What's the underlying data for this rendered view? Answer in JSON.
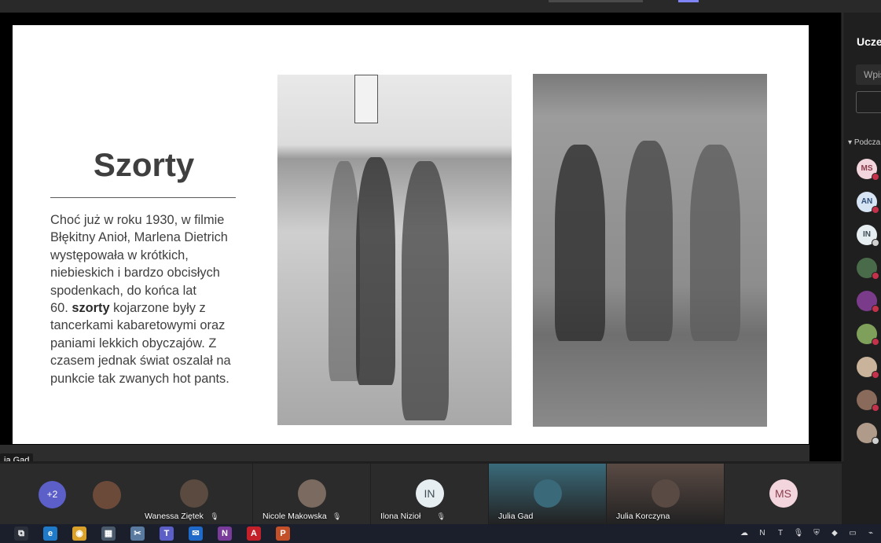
{
  "slide": {
    "title": "Szorty",
    "body_before": "Choć już w roku 1930, w filmie\nBłękitny Anioł, Marlena Dietrich\nwystępowała w krótkich,\nniebieskich i bardzo obcisłych\nspodenkach, do końca lat\n60. ",
    "body_bold": "szorty",
    "body_after": " kojarzone były z\ntancerkami kabaretowymi oraz\npaniami lekkich obyczajów. Z\nczasem jednak świat oszalał na\npunkcie tak zwanych  hot pants."
  },
  "speaker_tooltip": "ia Gad",
  "roster": {
    "title": "Uczes",
    "search_placeholder": "Wpis",
    "section_label": "Podcza",
    "people": [
      {
        "initials": "MS",
        "bg": "#f3d6dd",
        "fg": "#8a3b4c",
        "status": "muted"
      },
      {
        "initials": "AN",
        "bg": "#d6e4f3",
        "fg": "#2f4e7a",
        "status": "muted"
      },
      {
        "initials": "IN",
        "bg": "#e6eef1",
        "fg": "#3d4d55",
        "status": "unmuted"
      },
      {
        "initials": "",
        "bg": "#4a6b4a",
        "fg": "#fff",
        "status": "muted"
      },
      {
        "initials": "",
        "bg": "#7a3c8a",
        "fg": "#fff",
        "status": "muted"
      },
      {
        "initials": "",
        "bg": "#7fa05a",
        "fg": "#fff",
        "status": "muted"
      },
      {
        "initials": "",
        "bg": "#c9b39a",
        "fg": "#fff",
        "status": "muted"
      },
      {
        "initials": "",
        "bg": "#8a6a5a",
        "fg": "#fff",
        "status": "muted"
      },
      {
        "initials": "",
        "bg": "#b09a8a",
        "fg": "#fff",
        "status": "unmuted"
      }
    ]
  },
  "tiles": {
    "overflow_count": "+2",
    "participants": [
      {
        "name": "",
        "initials": "",
        "bg": "#6b4a3a"
      },
      {
        "name": "Wanessa Ziętek",
        "initials": "",
        "bg": "#5a4a40",
        "muted": true
      },
      {
        "name": "Nicole Makowska",
        "initials": "",
        "bg": "#7a6a60",
        "muted": true
      },
      {
        "name": "Ilona Nizioł",
        "initials": "IN",
        "bg": "#e6eef1",
        "muted": true
      },
      {
        "name": "Julia Gad",
        "initials": "",
        "bg": "#3a6a7a",
        "muted": false
      },
      {
        "name": "Julia Korczyna",
        "initials": "",
        "bg": "#5a4a44",
        "muted": false
      },
      {
        "name": "",
        "initials": "MS",
        "bg": "#f3d6dd",
        "muted": false
      }
    ]
  },
  "taskbar": {
    "apps": [
      {
        "icon": "task-view-icon",
        "glyph": "⧉",
        "color": "#2b2f3a"
      },
      {
        "icon": "edge-icon",
        "glyph": "e",
        "color": "#1f7ac8"
      },
      {
        "icon": "chrome-icon",
        "glyph": "◉",
        "color": "#d9a02a"
      },
      {
        "icon": "calculator-icon",
        "glyph": "▦",
        "color": "#4a5a6a"
      },
      {
        "icon": "snipping-icon",
        "glyph": "✂",
        "color": "#5a7aa0"
      },
      {
        "icon": "teams-icon",
        "glyph": "T",
        "color": "#5b5fc7"
      },
      {
        "icon": "mail-icon",
        "glyph": "✉",
        "color": "#1f6ac8"
      },
      {
        "icon": "onenote-icon",
        "glyph": "N",
        "color": "#7a3c9a"
      },
      {
        "icon": "acrobat-icon",
        "glyph": "A",
        "color": "#c4202a"
      },
      {
        "icon": "powerpoint-icon",
        "glyph": "P",
        "color": "#c4502a"
      }
    ],
    "tray": [
      {
        "icon": "onedrive-icon",
        "glyph": "☁"
      },
      {
        "icon": "onenote-tray-icon",
        "glyph": "N"
      },
      {
        "icon": "teams-tray-icon",
        "glyph": "T"
      },
      {
        "icon": "microphone-icon",
        "glyph": "🎙"
      },
      {
        "icon": "security-icon",
        "glyph": "⛨"
      },
      {
        "icon": "nvidia-icon",
        "glyph": "◆"
      },
      {
        "icon": "display-icon",
        "glyph": "▭"
      },
      {
        "icon": "network-icon",
        "glyph": "⌁"
      }
    ]
  }
}
